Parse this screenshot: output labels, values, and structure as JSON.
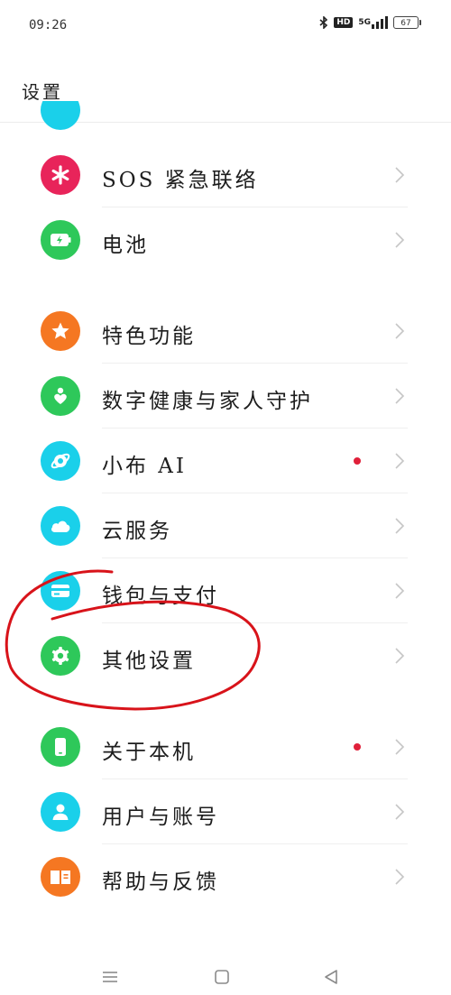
{
  "status_bar": {
    "time": "09:26",
    "network": "5G",
    "hd": "HD",
    "battery": "67"
  },
  "page": {
    "title": "设置"
  },
  "items": [
    {
      "label": "SOS 紧急联络",
      "icon": "asterisk-icon",
      "color": "#e8245a",
      "dot": false
    },
    {
      "label": "电池",
      "icon": "battery-icon",
      "color": "#2ec85a",
      "dot": false
    },
    {
      "label": "特色功能",
      "icon": "star-icon",
      "color": "#f57722",
      "dot": false
    },
    {
      "label": "数字健康与家人守护",
      "icon": "heart-person-icon",
      "color": "#2ec85a",
      "dot": false
    },
    {
      "label": "小布 AI",
      "icon": "ai-assistant-icon",
      "color": "#1ad0ea",
      "dot": true
    },
    {
      "label": "云服务",
      "icon": "cloud-icon",
      "color": "#1ad0ea",
      "dot": false
    },
    {
      "label": "钱包与支付",
      "icon": "card-icon",
      "color": "#1ad0ea",
      "dot": false
    },
    {
      "label": "其他设置",
      "icon": "gear-icon",
      "color": "#2ec85a",
      "dot": false
    },
    {
      "label": "关于本机",
      "icon": "phone-icon",
      "color": "#2ec85a",
      "dot": true
    },
    {
      "label": "用户与账号",
      "icon": "user-icon",
      "color": "#1ad0ea",
      "dot": false
    },
    {
      "label": "帮助与反馈",
      "icon": "book-icon",
      "color": "#f57722",
      "dot": false
    }
  ],
  "colors": {
    "annotation": "#d8131a",
    "dot": "#e0203a"
  }
}
